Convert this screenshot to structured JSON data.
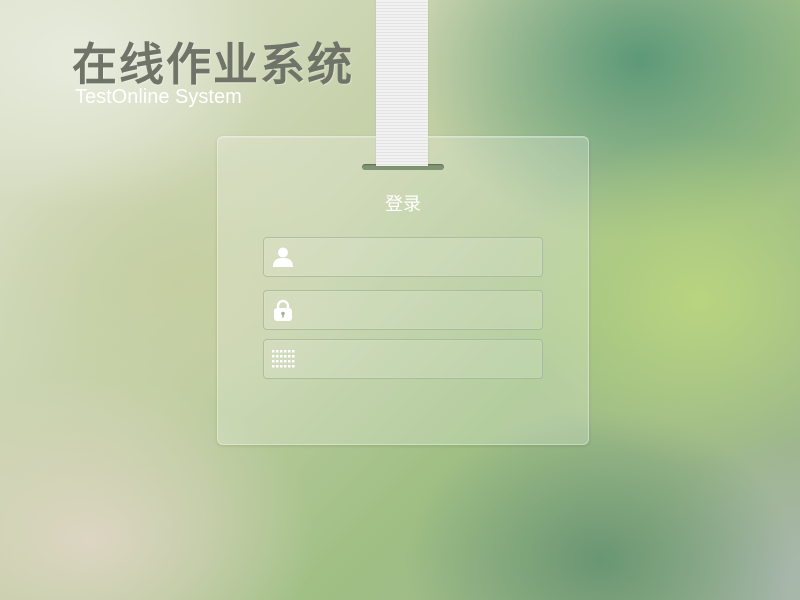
{
  "header": {
    "title": "在线作业系统",
    "subtitle": "TestOnline System"
  },
  "login_card": {
    "title": "登录",
    "fields": {
      "username": {
        "icon": "user-icon",
        "value": "",
        "placeholder": ""
      },
      "password": {
        "icon": "lock-icon",
        "value": "",
        "placeholder": ""
      },
      "captcha": {
        "icon": "keypad-icon",
        "value": "",
        "placeholder": ""
      }
    }
  },
  "colors": {
    "title_text": "#6f7468",
    "subtitle_text": "#ffffff",
    "login_title_text": "#ffffff",
    "lanyard": "#f0f0f0",
    "card_slot": "#7f9472"
  }
}
